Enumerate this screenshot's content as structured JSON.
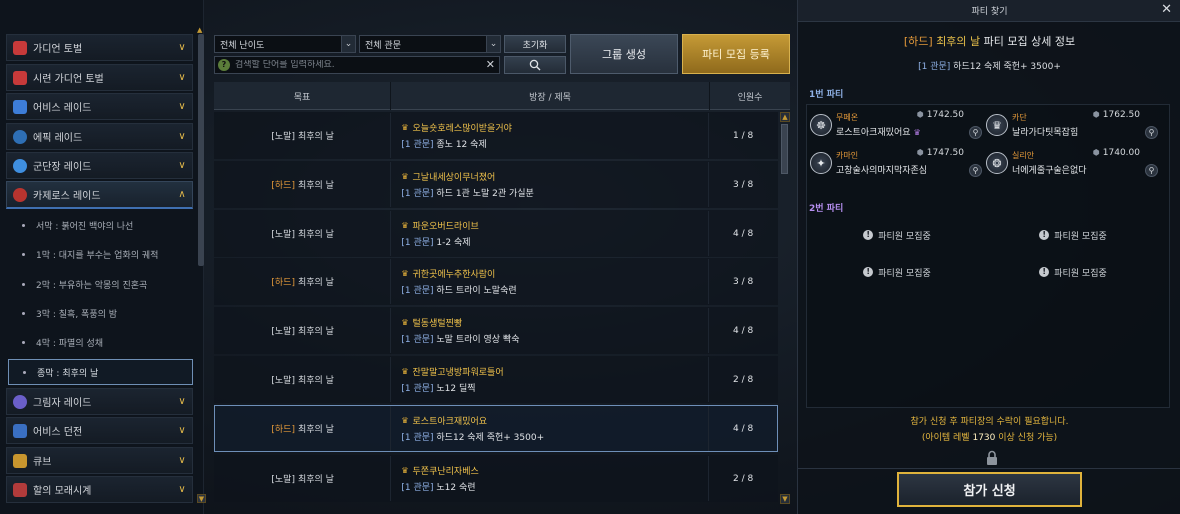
{
  "sidebar": {
    "categories_top": [
      {
        "label": "가디언 토벌",
        "icon": "guardian-icon",
        "color": "#c73a3a",
        "chevron": "∨"
      },
      {
        "label": "시련 가디언 토벌",
        "icon": "trial-guardian-icon",
        "color": "#c73a3a",
        "chevron": "∨"
      },
      {
        "label": "어비스 레이드",
        "icon": "abyss-raid-icon",
        "color": "#3d7dd8",
        "chevron": "∨"
      },
      {
        "label": "에픽 레이드",
        "icon": "epic-raid-icon",
        "color": "#2e6fb5",
        "chevron": "∨"
      },
      {
        "label": "군단장 레이드",
        "icon": "legion-raid-icon",
        "color": "#3f8fe0",
        "chevron": "∨"
      },
      {
        "label": "카제로스 레이드",
        "icon": "kazeros-raid-icon",
        "color": "#b8342f",
        "chevron": "∧"
      }
    ],
    "sub_items": [
      {
        "label": "서막 : 붉어진 백야의 나선"
      },
      {
        "label": "1막 : 대지를 부수는 업화의 궤적"
      },
      {
        "label": "2막 : 부유하는 악몽의 진혼곡"
      },
      {
        "label": "3막 : 칠흑, 폭풍의 밤"
      },
      {
        "label": "4막 : 파멸의 성채"
      },
      {
        "label": "종막 : 최후의 날"
      }
    ],
    "categories_bottom": [
      {
        "label": "그림자 레이드",
        "icon": "shadow-raid-icon",
        "color": "#6b5fc9",
        "chevron": "∨"
      },
      {
        "label": "어비스 던전",
        "icon": "abyss-dungeon-icon",
        "color": "#3a6fc2",
        "chevron": "∨"
      },
      {
        "label": "큐브",
        "icon": "cube-icon",
        "color": "#c9962e",
        "chevron": "∨"
      },
      {
        "label": "할의 모래시계",
        "icon": "hourglass-icon",
        "color": "#b23b3b",
        "chevron": "∨"
      }
    ]
  },
  "toolbar": {
    "difficulty_select": "전체 난이도",
    "gate_select": "전체 관문",
    "search_placeholder": "검색할 단어를 입력하세요.",
    "reset_label": "초기화",
    "group_label": "그룹 생성",
    "recruit_label": "파티 모집 등록"
  },
  "table": {
    "headers": [
      "목표",
      "방장 / 제목",
      "인원수"
    ],
    "rows": [
      {
        "diff": "[노말]",
        "diff_type": "normal",
        "target": "최후의 날",
        "leader": "오늘숏호레스많이받을거야",
        "gate": "[1 관문]",
        "title": "종노 12 숙제",
        "count": "1 / 8"
      },
      {
        "diff": "[하드]",
        "diff_type": "hard",
        "target": "최후의 날",
        "leader": "그날내세상이무너졌어",
        "gate": "[1 관문]",
        "title": "하드 1관 노말 2관 가실분",
        "count": "3 / 8"
      },
      {
        "diff": "[노말]",
        "diff_type": "normal",
        "target": "최후의 날",
        "leader": "파운오버드라이브",
        "gate": "[1 관문]",
        "title": "1-2 숙제",
        "count": "4 / 8"
      },
      {
        "diff": "[하드]",
        "diff_type": "hard",
        "target": "최후의 날",
        "leader": "귀한곳에누추한사람이",
        "gate": "[1 관문]",
        "title": "하드 트라이 노말숙련",
        "count": "3 / 8"
      },
      {
        "diff": "[노말]",
        "diff_type": "normal",
        "target": "최후의 날",
        "leader": "털동생털찐빵",
        "gate": "[1 관문]",
        "title": "노말 트라이 영상 빡숙",
        "count": "4 / 8"
      },
      {
        "diff": "[노말]",
        "diff_type": "normal",
        "target": "최후의 날",
        "leader": "잔말말고냉방파워로틀어",
        "gate": "[1 관문]",
        "title": "노12 딜찍",
        "count": "2 / 8"
      },
      {
        "diff": "[하드]",
        "diff_type": "hard",
        "target": "최후의 날",
        "leader": "로스트아크재밌어요",
        "gate": "[1 관문]",
        "title": "하드12 숙제 죽헌+ 3500+",
        "count": "4 / 8"
      },
      {
        "diff": "[노말]",
        "diff_type": "normal",
        "target": "최후의 날",
        "leader": "두쫀쿠난리자베스",
        "gate": "[1 관문]",
        "title": "노12 숙련",
        "count": "2 / 8"
      }
    ]
  },
  "panel": {
    "title": "파티 찾기",
    "detail_diff": "[하드]",
    "detail_raid": "최후의 날",
    "detail_suffix": "파티 모집 상세 정보",
    "detail_gate": "[1 관문]",
    "detail_sub": "하드12 숙제 죽헌+ 3500+",
    "party1_label": "1번 파티",
    "party2_label": "2번 파티",
    "members": [
      {
        "cls": "무페온",
        "nick": "로스트아크재밌어요",
        "level": "1742.50",
        "leader": true,
        "avatar": "☸"
      },
      {
        "cls": "카단",
        "nick": "날라가다팃목잡힘",
        "level": "1762.50",
        "leader": false,
        "avatar": "♛"
      },
      {
        "cls": "카마인",
        "nick": "고창술사의마지막자존심",
        "level": "1747.50",
        "leader": false,
        "avatar": "✦"
      },
      {
        "cls": "실리안",
        "nick": "너에게줄구술은없다",
        "level": "1740.00",
        "leader": false,
        "avatar": "❂"
      }
    ],
    "vacant_label": "파티원 모집중",
    "notice_line1": "참가 신청 후 파티장의 수락이 필요합니다.",
    "notice_line2_prefix": "(아이템 레벨",
    "notice_level": "1730",
    "notice_line2_suffix": "이상 신청 가능)",
    "join_label": "참가 신청"
  },
  "colors": {
    "hard": "#e59a3a",
    "gate": "#8fb1e6",
    "leader_name": "#f0c24b",
    "accent_gold": "#c59a36"
  }
}
